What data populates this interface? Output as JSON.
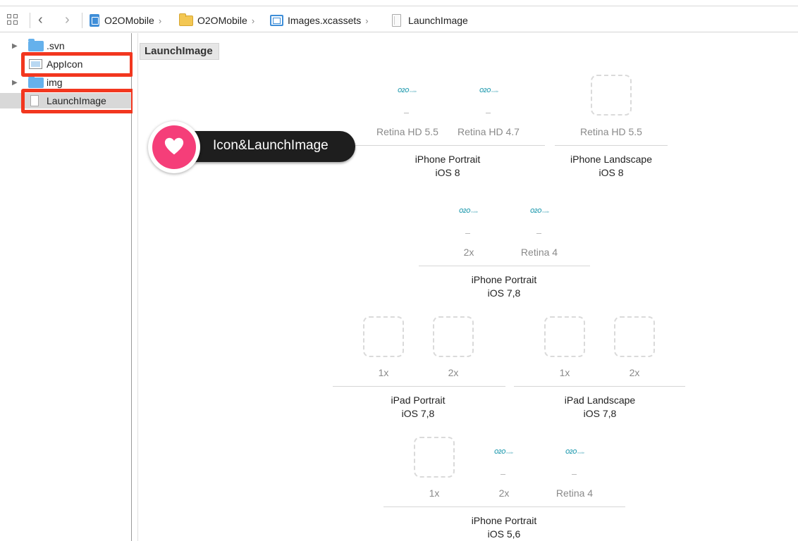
{
  "jumpbar": {
    "crumbs": [
      "O2OMobile",
      "O2OMobile",
      "Images.xcassets",
      "LaunchImage"
    ]
  },
  "navigator": {
    "items": [
      {
        "label": ".svn",
        "icon": "folder-icon"
      },
      {
        "label": "AppIcon",
        "icon": "app-icon-set-icon"
      },
      {
        "label": "img",
        "icon": "folder-icon"
      },
      {
        "label": "LaunchImage",
        "icon": "launch-image-set-icon"
      }
    ]
  },
  "editor": {
    "title": "LaunchImage",
    "callout": "Icon&LaunchImage",
    "groups": [
      {
        "slots": [
          "Retina HD 5.5",
          "Retina HD 4.7"
        ],
        "title": "iPhone Portrait",
        "sub": "iOS 8"
      },
      {
        "slots": [
          "Retina HD 5.5"
        ],
        "title": "iPhone Landscape",
        "sub": "iOS 8"
      },
      {
        "slots": [
          "2x",
          "Retina 4"
        ],
        "title": "iPhone Portrait",
        "sub": "iOS 7,8"
      },
      {
        "slots": [
          "1x",
          "2x"
        ],
        "title": "iPad Portrait",
        "sub": "iOS 7,8"
      },
      {
        "slots": [
          "1x",
          "2x"
        ],
        "title": "iPad Landscape",
        "sub": "iOS 7,8"
      },
      {
        "slots": [
          "1x",
          "2x",
          "Retina 4"
        ],
        "title": "iPhone Portrait",
        "sub": "iOS 5,6"
      }
    ],
    "thumb_logo": "O2O",
    "thumb_logo_small": "mobile"
  },
  "colors": {
    "highlight": "#f2371f",
    "callout_pink": "#f53e79",
    "selection": "#d8d8d8"
  }
}
